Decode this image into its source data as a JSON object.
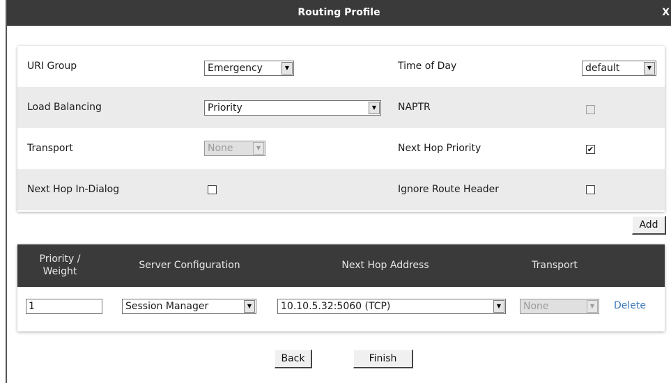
{
  "dialog": {
    "title": "Routing Profile",
    "close_label": "X"
  },
  "form": {
    "uri_group": {
      "label": "URI Group",
      "value": "Emergency"
    },
    "time_of_day": {
      "label": "Time of Day",
      "value": "default"
    },
    "load_balancing": {
      "label": "Load Balancing",
      "value": "Priority"
    },
    "naptr": {
      "label": "NAPTR",
      "checked": false,
      "disabled": true
    },
    "transport": {
      "label": "Transport",
      "value": "None",
      "disabled": true
    },
    "next_hop_priority": {
      "label": "Next Hop Priority",
      "checked": true
    },
    "next_hop_in_dialog": {
      "label": "Next Hop In-Dialog",
      "checked": false
    },
    "ignore_route_header": {
      "label": "Ignore Route Header",
      "checked": false
    }
  },
  "add_label": "Add",
  "table": {
    "headers": {
      "priority_line1": "Priority /",
      "priority_line2": "Weight",
      "server_configuration": "Server Configuration",
      "next_hop_address": "Next Hop Address",
      "transport": "Transport"
    },
    "rows": [
      {
        "priority": "1",
        "server_configuration": "Session Manager",
        "next_hop_address": "10.10.5.32:5060 (TCP)",
        "transport": "None",
        "delete_label": "Delete"
      }
    ]
  },
  "footer": {
    "back_label": "Back",
    "finish_label": "Finish"
  },
  "icons": {
    "dropdown": "chevron-down-icon",
    "check": "check-icon"
  }
}
